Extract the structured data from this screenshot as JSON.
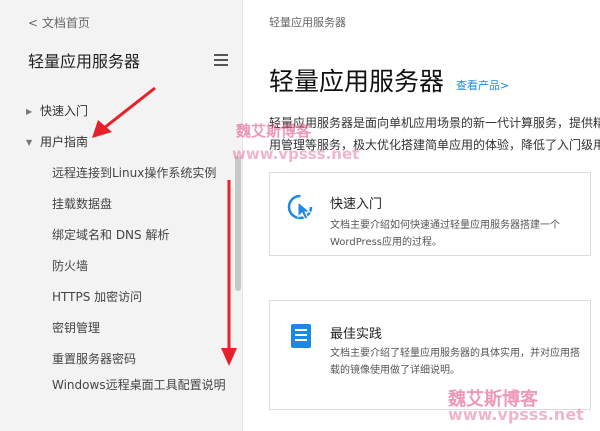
{
  "sidebar": {
    "back_label": "< 文档首页",
    "title": "轻量应用服务器",
    "items": [
      {
        "label": "快速入门",
        "caret": "▶"
      },
      {
        "label": "用户指南",
        "caret": "▼"
      }
    ],
    "sub_items": [
      "远程连接到Linux操作系统实例",
      "挂载数据盘",
      "绑定域名和 DNS 解析",
      "防火墙",
      "HTTPS 加密访问",
      "密钥管理",
      "重置服务器密码",
      "Windows远程桌面工具配置说明"
    ]
  },
  "main": {
    "breadcrumb": "轻量应用服务器",
    "title": "轻量应用服务器",
    "title_link": "查看产品>",
    "intro_line1": "轻量应用服务器是面向单机应用场景的新一代计算服务，提供精",
    "intro_line2": "用管理等服务，极大优化搭建简单应用的体验，降低了入门级用",
    "cards": [
      {
        "title": "快速入门",
        "desc": "文档主要介绍如何快速通过轻量应用服务器搭建一个WordPress应用的过程。",
        "icon": "cursor-click-icon"
      },
      {
        "title": "最佳实践",
        "desc": "文档主要介绍了轻量应用服务器的具体实用，并对应用搭载的镜像使用做了详细说明。",
        "icon": "document-icon"
      }
    ]
  },
  "watermarks": {
    "top_name": "魏艾斯博客",
    "top_url": "www.vpsss.net",
    "bottom_name": "魏艾斯博客",
    "bottom_url": "www.vpsss.net"
  },
  "colors": {
    "accent": "#1e88e5",
    "arrow": "#e8202a",
    "watermark": "#e0457b",
    "sidebar_bg": "#f3f3f3"
  }
}
